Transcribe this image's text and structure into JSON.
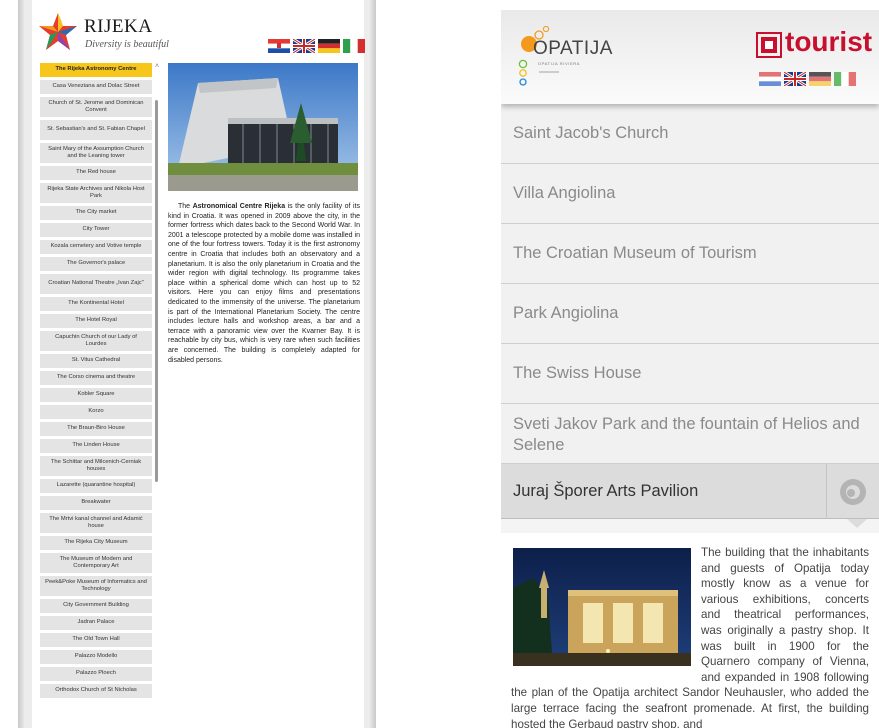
{
  "rijeka": {
    "title": "RIJEKA",
    "tagline": "Diversity is beautiful",
    "languages": [
      "Croatian",
      "English",
      "German",
      "Italian"
    ],
    "menu": [
      {
        "label": "The Rijeka Astronomy Centre",
        "active": true
      },
      {
        "label": "Casa Veneziana and Dolac Street"
      },
      {
        "label": "Church of St. Jerome and Dominican Convent",
        "tall": true
      },
      {
        "label": "St. Sebastian's and St. Fabian Chapel",
        "tall": true
      },
      {
        "label": "Saint Mary of the Assumption Church and the Leaning tower",
        "tall": true
      },
      {
        "label": "The Red house"
      },
      {
        "label": "Rijeka State Archives and Nikola Host Park",
        "tall": true
      },
      {
        "label": "The City market"
      },
      {
        "label": "City Tower"
      },
      {
        "label": "Kozala cemetery and Votive temple"
      },
      {
        "label": "The Governor's palace"
      },
      {
        "label": "Croatian National Theatre „Ivan Zajc\"",
        "tall": true
      },
      {
        "label": "The Kontinental Hotel"
      },
      {
        "label": "The Hotel Royal"
      },
      {
        "label": "Capuchin Church of our Lady of Lourdes",
        "tall": true
      },
      {
        "label": "St. Vitus Cathedral"
      },
      {
        "label": "The Corso cinema and theatre"
      },
      {
        "label": "Kobler Square"
      },
      {
        "label": "Korzo"
      },
      {
        "label": "The Braun-Biro House"
      },
      {
        "label": "The Linden House"
      },
      {
        "label": "The Schittar and Milcenich-Cerniak houses",
        "tall": true
      },
      {
        "label": "Lazarette (quarantine hospital)"
      },
      {
        "label": "Breakwater"
      },
      {
        "label": "The Mrtvi kanal channel and Adamić house",
        "tall": true
      },
      {
        "label": "The Rijeka City Museum"
      },
      {
        "label": "The Museum of Modern and Contemporary Art",
        "tall": true
      },
      {
        "label": "Peek&Poke Museum of Informatics and Technology",
        "tall": true
      },
      {
        "label": "City Government Building"
      },
      {
        "label": "Jadran Palace"
      },
      {
        "label": "The Old Town Hall"
      },
      {
        "label": "Palazzo Modello"
      },
      {
        "label": "Palazzo Ploech"
      },
      {
        "label": "Orthodox Church of St Nicholas"
      }
    ],
    "article_bold": "Astronomical Centre Rijeka",
    "article_pre": "The ",
    "article_post": " is the only facility of its kind in Croatia. It was opened in 2009 above the city, in the former fortress which dates back to the Second World War. In 2001 a telescope protected by a mobile dome was installed in one of the four fortress towers. Today it is the first astronomy centre in Croatia that includes both an observatory and a planetarium. It is also the only planetarium in Croatia and the wider region with digital technology. Its programme takes place within a spherical dome which can host up to 52 visitors. Here you can enjoy films and presentations dedicated to the immensity of the universe. The planetarium is part of the International Planetarium Society. The centre includes lecture halls and workshop areas, a bar and a terrace with a panoramic view over the Kvarner Bay. It is reachable by city bus, which is very rare when such facilities are concerned. The building is completely adapted for disabled persons."
  },
  "opatija": {
    "title": "OPATIJA",
    "subtitle": "OPATIJA RIVIERA",
    "brand": "tourist",
    "languages": [
      "Croatian",
      "English",
      "German",
      "Italian"
    ],
    "list": [
      {
        "label": "Saint Jacob's Church"
      },
      {
        "label": "Villa Angiolina"
      },
      {
        "label": "The Croatian Museum of Tourism"
      },
      {
        "label": "Park Angiolina"
      },
      {
        "label": "The Swiss House"
      },
      {
        "label": "Sveti Jakov Park and the fountain of Helios and Selene"
      }
    ],
    "active_item": "Juraj Šporer Arts Pavilion",
    "description": "The building that the inhabitants and guests of Opatija today mostly know as a venue for various exhibitions, concerts and theatrical performances, was originally a pastry shop. It was built in 1900 for the Quarnero company of Vienna, and expanded in 1908 following the plan of the Opatija architect Sandor Neuhausler, who added the large terrace facing the seafront promenade. At first, the building hosted the Gerbaud pastry shop, and"
  },
  "colors": {
    "rijeka_active": "#f7c61a",
    "opatija_brand": "#c8102e",
    "opatija_orange": "#f39a1e"
  }
}
